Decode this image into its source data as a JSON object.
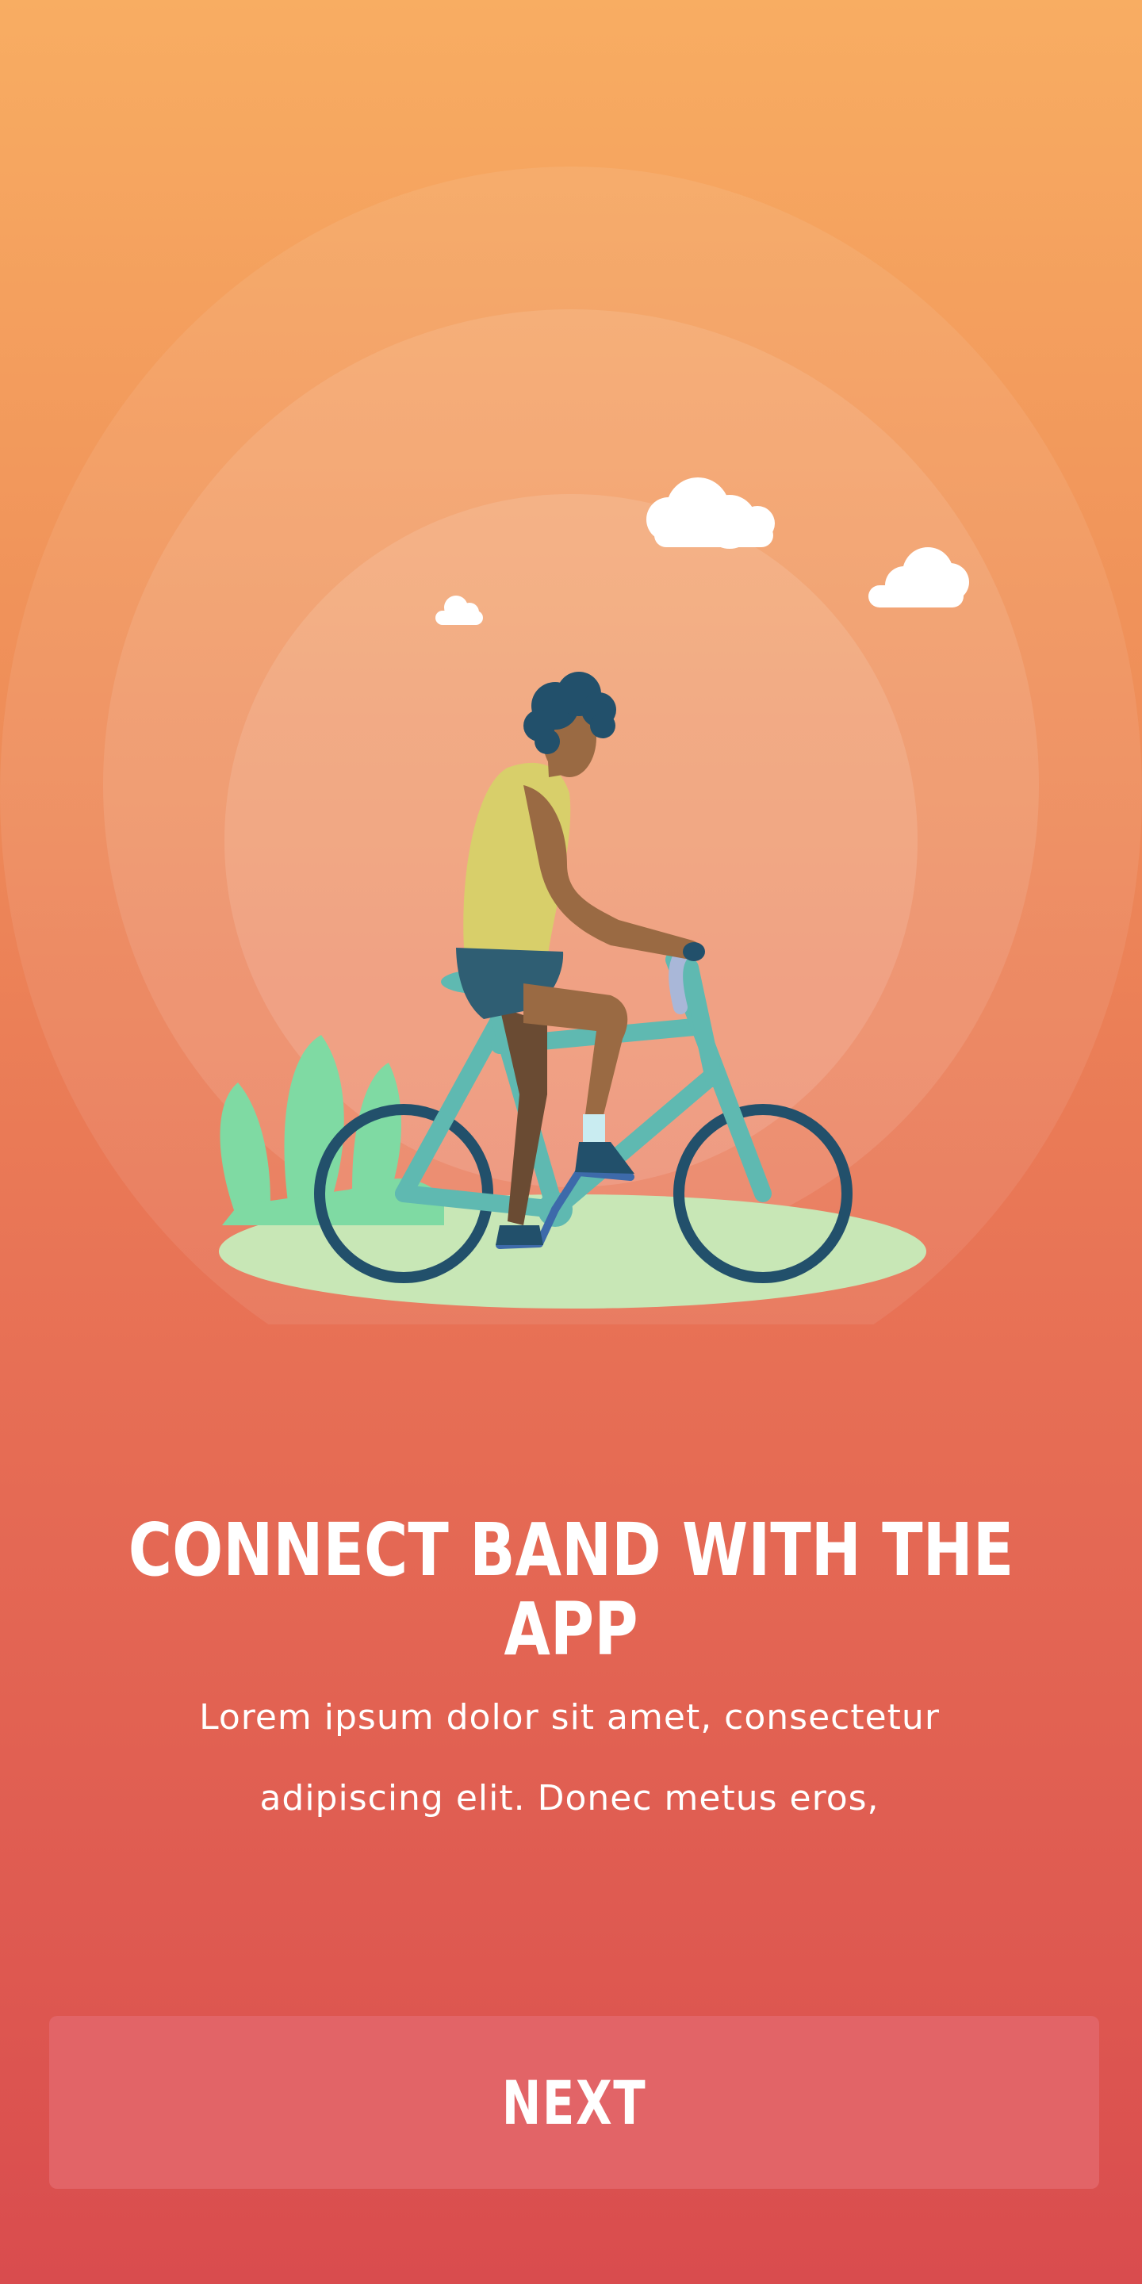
{
  "onboarding": {
    "title": "CONNECT BAND WITH THE APP",
    "description": "Lorem ipsum dolor sit amet, consectetur adipiscing elit. Donec metus eros,",
    "next_label": "NEXT"
  },
  "illustration": {
    "subject": "person riding a bicycle in front of a setting sun",
    "icon": "cyclist-illustration"
  },
  "colors": {
    "background_top": "#f8ad62",
    "background_bottom": "#d94c4e",
    "button": "#e26467",
    "text": "#ffffff"
  }
}
